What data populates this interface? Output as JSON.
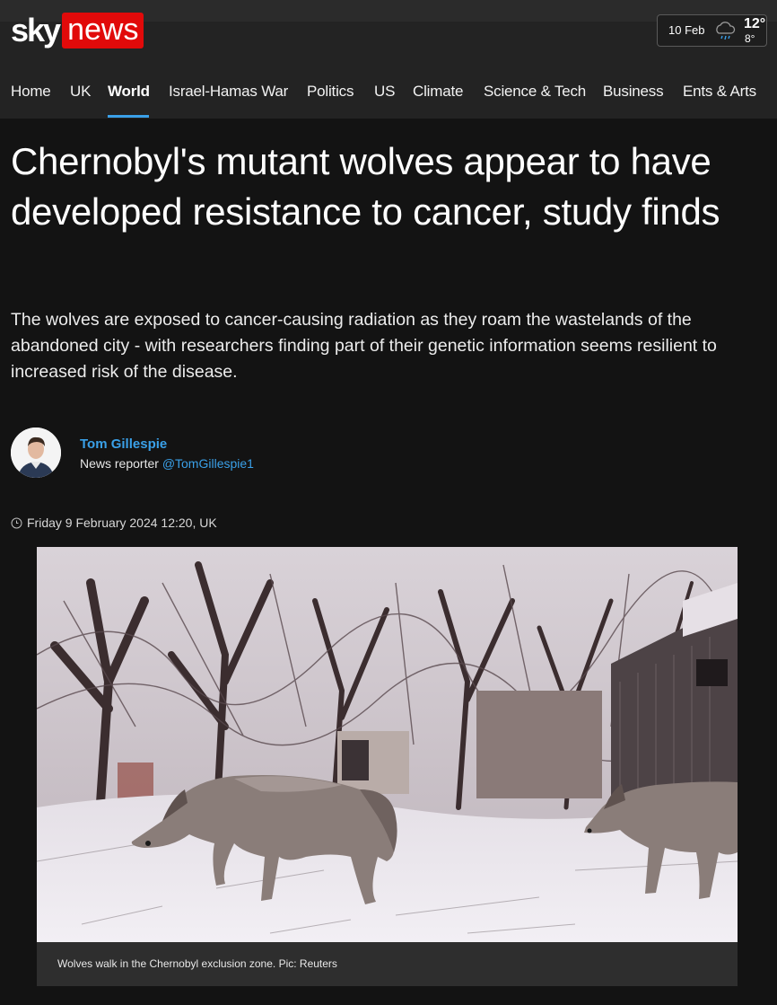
{
  "brand": {
    "sky": "sky",
    "news": "news"
  },
  "weather": {
    "date": "10 Feb",
    "high": "12°",
    "low": "8°",
    "icon": "rain-cloud-icon"
  },
  "nav": {
    "items": [
      {
        "label": "Home"
      },
      {
        "label": "UK"
      },
      {
        "label": "World",
        "active": true
      },
      {
        "label": "Israel-Hamas War"
      },
      {
        "label": "Politics"
      },
      {
        "label": "US"
      },
      {
        "label": "Climate"
      },
      {
        "label": "Science & Tech"
      },
      {
        "label": "Business"
      },
      {
        "label": "Ents & Arts"
      }
    ]
  },
  "article": {
    "headline": "Chernobyl's mutant wolves appear to have developed resistance to cancer, study finds",
    "standfirst": "The wolves are exposed to cancer-causing radiation as they roam the wastelands of the abandoned city - with researchers finding part of their genetic information seems resilient to increased risk of the disease.",
    "author": {
      "name": "Tom Gillespie",
      "role": "News reporter",
      "handle": "@TomGillespie1"
    },
    "timestamp": "Friday 9 February 2024 12:20, UK",
    "image_caption": "Wolves walk in the Chernobyl exclusion zone. Pic: Reuters"
  },
  "colors": {
    "accent": "#3aa0e8",
    "brand_red": "#e10a0a",
    "background": "#131313"
  }
}
